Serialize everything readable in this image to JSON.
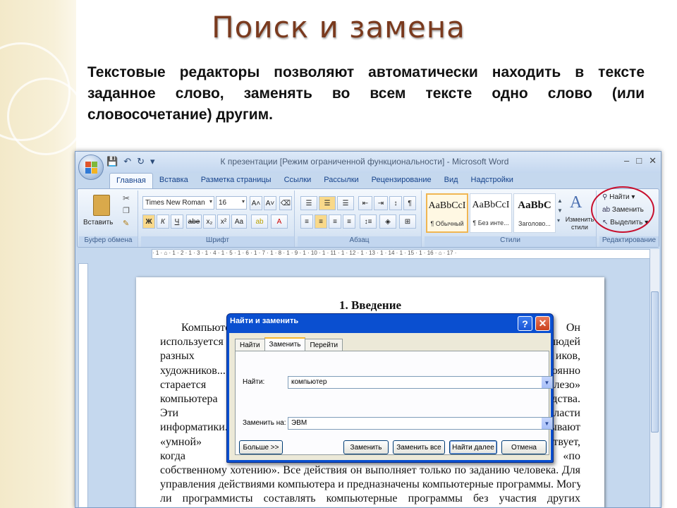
{
  "slide": {
    "title": "Поиск и замена",
    "text": "Текстовые редакторы позволяют автоматически находить в тексте заданное слово, заменять во всем тексте одно слово (или словосочетание) другим."
  },
  "window": {
    "title": "К презентации [Режим ограниченной функциональности] - Microsoft Word",
    "tabs": [
      "Главная",
      "Вставка",
      "Разметка страницы",
      "Ссылки",
      "Рассылки",
      "Рецензирование",
      "Вид",
      "Надстройки"
    ]
  },
  "ribbon": {
    "clipboard": {
      "paste_label": "Вставить",
      "group_label": "Буфер обмена"
    },
    "font": {
      "font_name": "Times New Roman",
      "font_size": "16",
      "group_label": "Шрифт"
    },
    "paragraph": {
      "group_label": "Абзац"
    },
    "styles": {
      "items": [
        {
          "preview": "AaBbCcI",
          "name": "¶ Обычный"
        },
        {
          "preview": "AaBbCcI",
          "name": "¶ Без инте..."
        },
        {
          "preview": "AaBbC",
          "name": "Заголово..."
        }
      ],
      "change_label": "Изменить стили",
      "group_label": "Стили"
    },
    "editing": {
      "find_label": "Найти",
      "replace_label": "Заменить",
      "select_label": "Выделить",
      "group_label": "Редактирование"
    }
  },
  "document": {
    "heading": "1. Введение",
    "lines": [
      "Компьютер                                                                                     . Он",
      "используется в                                                                                людей",
      "разных профе                                                                                  иков,",
      "художников...                                                                                 оянно",
      "старается рас                                                                                 лезо»",
      "компьютера н                                                                                  дства.",
      "Эти программ                                                                                  ласти",
      "информатики.                                                                                  ывают",
      "«умной» маш                                                                                   твует,",
      "когда захочет                                                                                 «по",
      "собственному хотению». Все действия он выполняет только по заданию человека. Для",
      "управления действиями компьютера и предназначены компьютерные программы. Могут",
      "ли программисты составлять компьютерные программы без участия других"
    ]
  },
  "dialog": {
    "title": "Найти и заменить",
    "tabs": [
      "Найти",
      "Заменить",
      "Перейти"
    ],
    "find_label": "Найти:",
    "find_value": "компьютер",
    "replace_label": "Заменить на:",
    "replace_value": "ЭВМ",
    "buttons": {
      "more": "Больше >>",
      "replace": "Заменить",
      "replace_all": "Заменить все",
      "find_next": "Найти далее",
      "cancel": "Отмена"
    }
  }
}
